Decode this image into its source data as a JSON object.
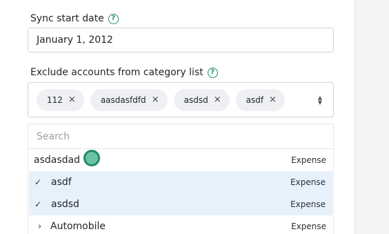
{
  "sync": {
    "label": "Sync start date",
    "help_icon": "question-circle-icon",
    "value": "January 1, 2012"
  },
  "exclude": {
    "label": "Exclude accounts from category list",
    "help_icon": "question-circle-icon",
    "chips": [
      {
        "label": "112",
        "remove": "×"
      },
      {
        "label": "aasdasfdfd",
        "remove": "×"
      },
      {
        "label": "asdsd",
        "remove": "×"
      },
      {
        "label": "asdf",
        "remove": "×"
      }
    ],
    "toggle_icon": "chevron-up-down-icon"
  },
  "dropdown": {
    "search_placeholder": "Search",
    "rows": [
      {
        "name": "asdasdad",
        "type": "Expense",
        "selected": false
      },
      {
        "name": "asdf",
        "type": "Expense",
        "selected": true,
        "check": "✓"
      },
      {
        "name": "asdsd",
        "type": "Expense",
        "selected": true,
        "check": "✓"
      },
      {
        "name": "Automobile",
        "type": "Expense",
        "selected": false,
        "expand": "›"
      }
    ]
  },
  "colors": {
    "accent": "#1f8a6f",
    "selected_row": "#e6f1fb",
    "chip_bg": "#eef0f3"
  }
}
